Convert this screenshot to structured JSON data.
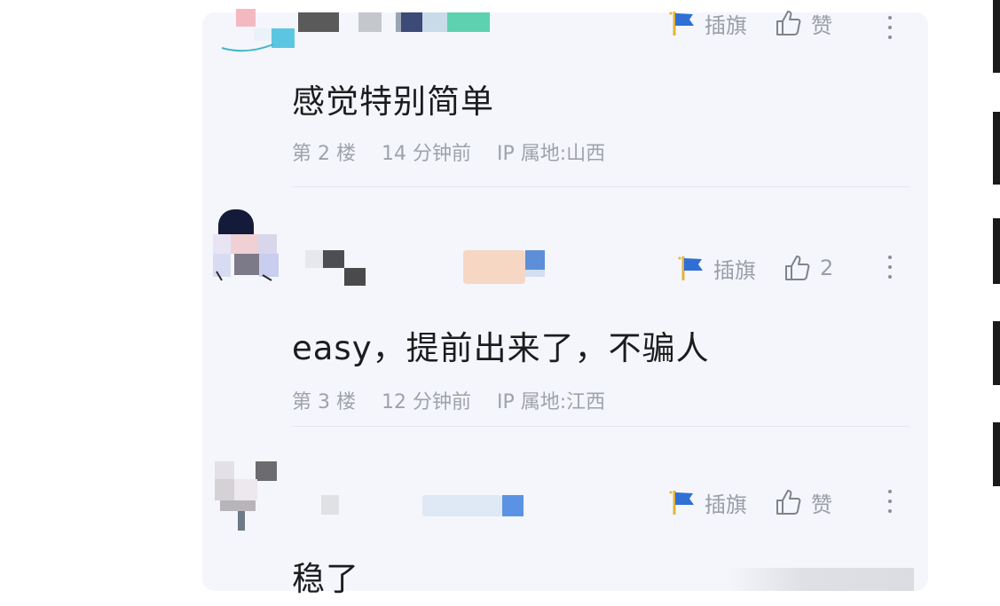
{
  "actions": {
    "flag_label": "插旗",
    "like_label": "赞"
  },
  "comments": [
    {
      "text": "感觉特别简单",
      "floor": "第 2 楼",
      "time": "14 分钟前",
      "ip": "IP 属地:山西",
      "like_text": "赞"
    },
    {
      "text": "easy，提前出来了，不骗人",
      "floor": "第 3 楼",
      "time": "12 分钟前",
      "ip": "IP 属地:江西",
      "like_text": "2"
    },
    {
      "text": "稳了",
      "like_text": "赞"
    }
  ],
  "colors": {
    "card_bg": "#f4f6fb",
    "flag_blue": "#2f6fd6",
    "flag_gold": "#e3b43b",
    "text_primary": "#1c1c1e",
    "text_secondary": "#9ea2aa"
  },
  "icons": {
    "flag": "flag-icon",
    "like": "thumbs-up-icon",
    "more": "more-vertical-icon"
  }
}
